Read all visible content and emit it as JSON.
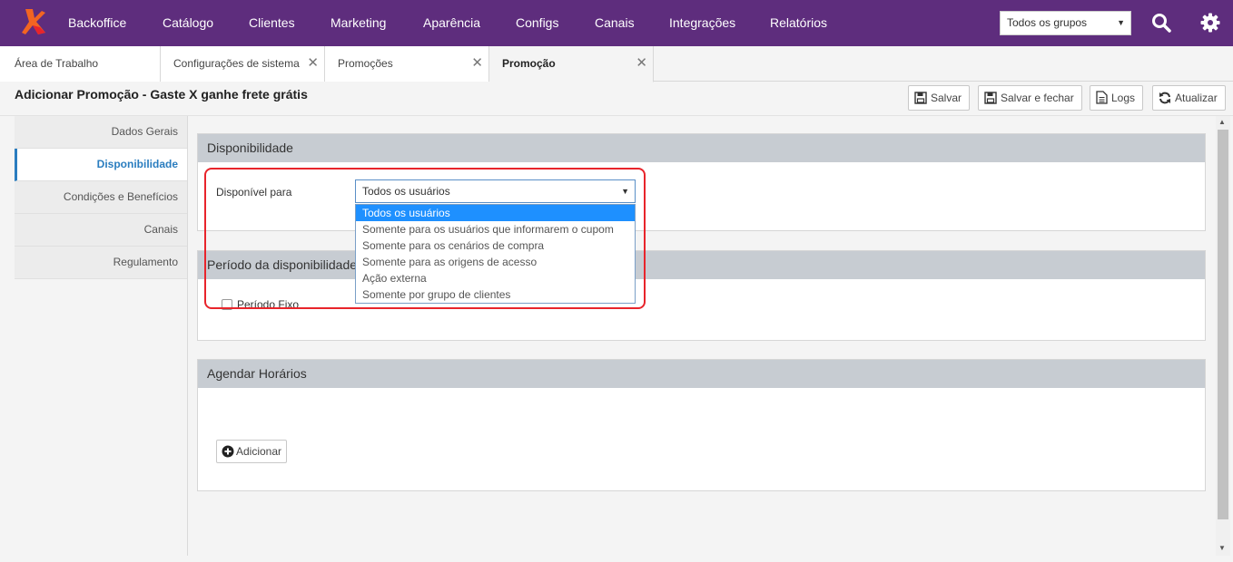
{
  "nav": {
    "items": [
      "Backoffice",
      "Catálogo",
      "Clientes",
      "Marketing",
      "Aparência",
      "Configs",
      "Canais",
      "Integrações",
      "Relatórios"
    ],
    "group_select": "Todos os grupos"
  },
  "tabs": [
    {
      "label": "Área de Trabalho"
    },
    {
      "label": "Configurações de sistema"
    },
    {
      "label": "Promoções"
    },
    {
      "label": "Promoção"
    }
  ],
  "page": {
    "title": "Adicionar Promoção - Gaste X ganhe frete grátis"
  },
  "toolbar": {
    "save": "Salvar",
    "save_close": "Salvar e fechar",
    "logs": "Logs",
    "refresh": "Atualizar"
  },
  "sidebar": {
    "items": [
      "Dados Gerais",
      "Disponibilidade",
      "Condições e Benefícios",
      "Canais",
      "Regulamento"
    ],
    "active": "Disponibilidade"
  },
  "availability": {
    "heading": "Disponibilidade",
    "field_label": "Disponível para",
    "selected": "Todos os usuários",
    "options": [
      "Todos os usuários",
      "Somente para os usuários que informarem o cupom",
      "Somente para os cenários de compra",
      "Somente para as origens de acesso",
      "Ação externa",
      "Somente por grupo de clientes"
    ]
  },
  "period": {
    "heading": "Período da disponibilidade",
    "checkbox_label": "Período Fixo"
  },
  "schedule": {
    "heading": "Agendar Horários",
    "add_label": "Adicionar"
  },
  "colors": {
    "topbar": "#5e2d7d",
    "accent_blue": "#2a7dbf",
    "highlight_red": "#e8242b",
    "option_selected": "#1e90ff"
  }
}
